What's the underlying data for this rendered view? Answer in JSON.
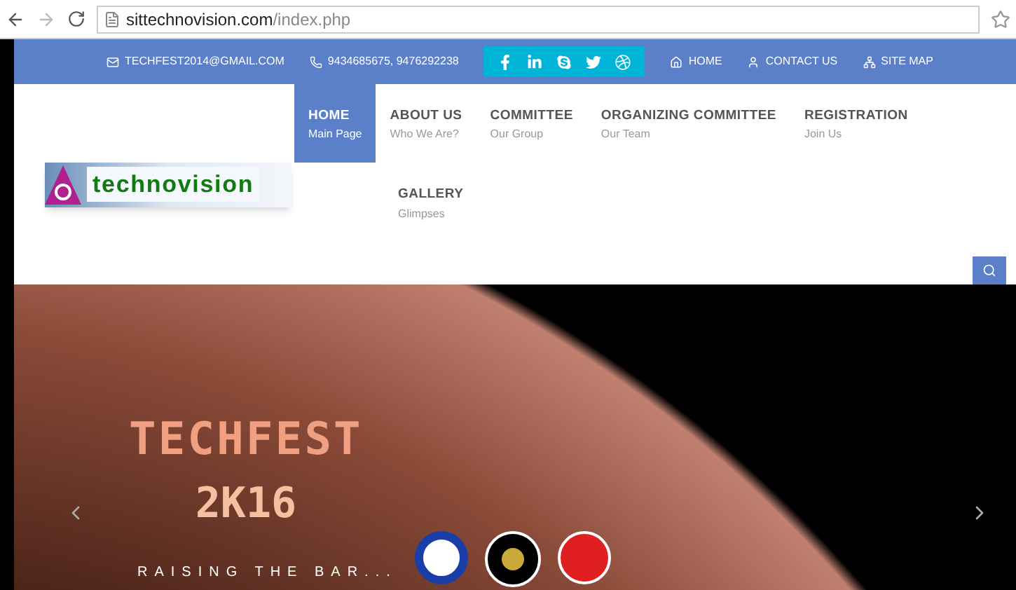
{
  "browser": {
    "url_host": "sittechnovision.com",
    "url_path": "/index.php"
  },
  "topbar": {
    "email": "TECHFEST2014@GMAIL.COM",
    "phone": "9434685675, 9476292238",
    "links": [
      {
        "label": "HOME",
        "kind": "home"
      },
      {
        "label": "CONTACT US",
        "kind": "user"
      },
      {
        "label": "SITE MAP",
        "kind": "sitemap"
      }
    ]
  },
  "logo": {
    "text": "technovision"
  },
  "nav": [
    {
      "title": "HOME",
      "subtitle": "Main Page",
      "selected": true
    },
    {
      "title": "ABOUT US",
      "subtitle": "Who We Are?",
      "selected": false
    },
    {
      "title": "COMMITTEE",
      "subtitle": "Our Group",
      "selected": false
    },
    {
      "title": "ORGANIZING COMMITTEE",
      "subtitle": "Our Team",
      "selected": false
    },
    {
      "title": "REGISTRATION",
      "subtitle": "Join Us",
      "selected": false
    },
    {
      "title": "GALLERY",
      "subtitle": "Glimpses",
      "selected": false
    }
  ],
  "hero": {
    "title": "TECHFEST",
    "subtitle": "2K16",
    "tagline": "RAISING THE BAR..."
  }
}
